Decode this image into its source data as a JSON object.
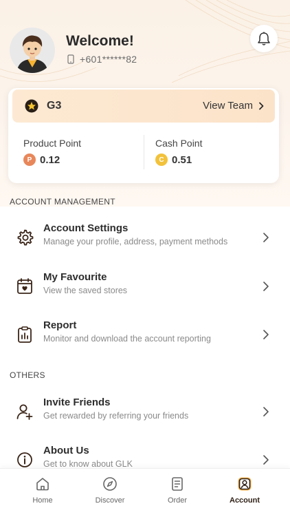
{
  "header": {
    "welcome": "Welcome!",
    "phone": "+601******82"
  },
  "membership": {
    "tier": "G3",
    "view_team_label": "View Team",
    "product_point": {
      "label": "Product Point",
      "coin": "P",
      "value": "0.12",
      "color": "#e8875a"
    },
    "cash_point": {
      "label": "Cash Point",
      "coin": "C",
      "value": "0.51",
      "color": "#f2c23b"
    }
  },
  "sections": {
    "account_management": "ACCOUNT MANAGEMENT",
    "others": "OTHERS"
  },
  "account_items": [
    {
      "icon": "gear-icon",
      "title": "Account Settings",
      "subtitle": "Manage your profile, address, payment methods"
    },
    {
      "icon": "favourite-calendar-icon",
      "title": "My Favourite",
      "subtitle": "View the saved stores"
    },
    {
      "icon": "report-clipboard-icon",
      "title": "Report",
      "subtitle": "Monitor and download the account reporting"
    }
  ],
  "other_items": [
    {
      "icon": "invite-user-icon",
      "title": "Invite Friends",
      "subtitle": "Get rewarded by referring your friends"
    },
    {
      "icon": "info-icon",
      "title": "About Us",
      "subtitle": "Get to know about GLK"
    }
  ],
  "tabs": [
    {
      "icon": "home-icon",
      "label": "Home",
      "active": false
    },
    {
      "icon": "compass-icon",
      "label": "Discover",
      "active": false
    },
    {
      "icon": "order-icon",
      "label": "Order",
      "active": false
    },
    {
      "icon": "account-icon",
      "label": "Account",
      "active": true
    }
  ],
  "colors": {
    "accent_dark": "#3a2417",
    "tier_bg": "#fbe3c9",
    "hero_bg": "#fbf1e6"
  }
}
